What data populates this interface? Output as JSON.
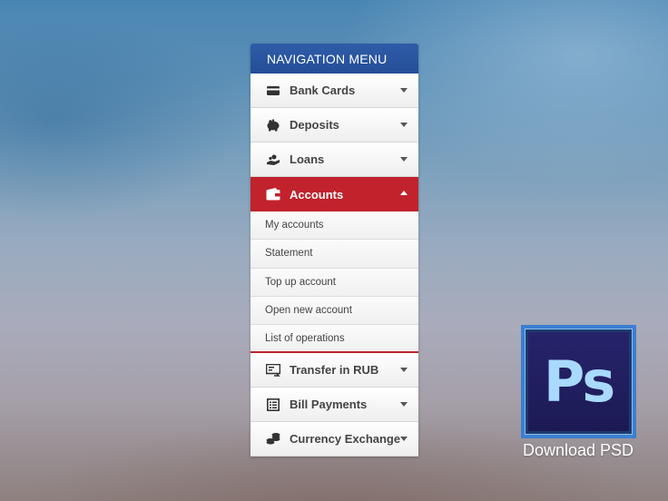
{
  "menu": {
    "title": "NAVIGATION MENU",
    "items": [
      {
        "label": "Bank Cards",
        "icon": "card-icon"
      },
      {
        "label": "Deposits",
        "icon": "piggy-bank-icon"
      },
      {
        "label": "Loans",
        "icon": "hand-coins-icon"
      },
      {
        "label": "Accounts",
        "icon": "wallet-icon",
        "active": true
      },
      {
        "label": "Transfer in RUB",
        "icon": "transfer-icon"
      },
      {
        "label": "Bill Payments",
        "icon": "list-icon"
      },
      {
        "label": "Currency Exchange",
        "icon": "coins-stack-icon"
      }
    ],
    "submenu": [
      "My accounts",
      "Statement",
      "Top up account",
      "Open new account",
      "List of operations"
    ]
  },
  "promo": {
    "logo_text": "Ps",
    "download_label": "Download PSD"
  },
  "colors": {
    "header": "#2a55a0",
    "active": "#c1222c",
    "ps_border": "#3b7fd1",
    "ps_text": "#a9d9ff"
  }
}
